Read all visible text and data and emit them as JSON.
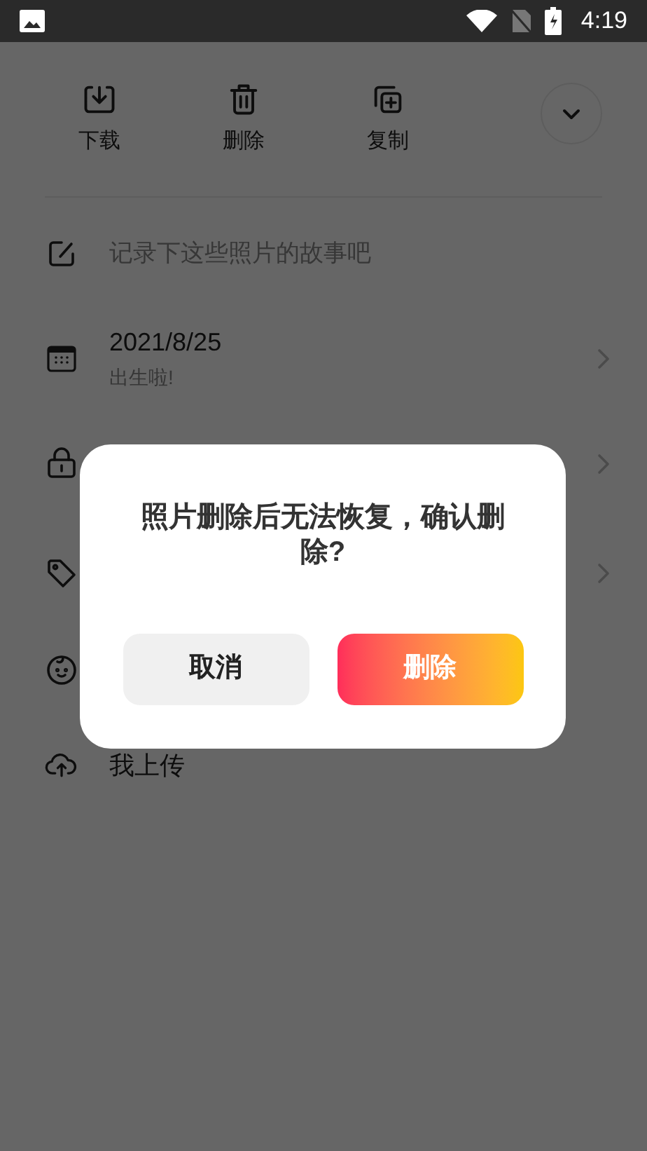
{
  "status_bar": {
    "time": "4:19"
  },
  "actions": [
    {
      "label": "下载"
    },
    {
      "label": "删除"
    },
    {
      "label": "复制"
    }
  ],
  "rows": [
    {
      "kind": "input",
      "placeholder": "记录下这些照片的故事吧"
    },
    {
      "kind": "link",
      "title": "2021/8/25",
      "subtitle": "出生啦!",
      "chevron": true
    },
    {
      "kind": "link",
      "chevron": true
    },
    {
      "kind": "link",
      "chevron": true
    },
    {
      "kind": "link",
      "chevron": false
    },
    {
      "kind": "link",
      "title": "我上传",
      "chevron": false
    }
  ],
  "dialog": {
    "message": "照片删除后无法恢复，确认删除?",
    "buttons": [
      {
        "label": "取消",
        "kind": "secondary"
      },
      {
        "label": "删除",
        "kind": "primary"
      }
    ]
  }
}
